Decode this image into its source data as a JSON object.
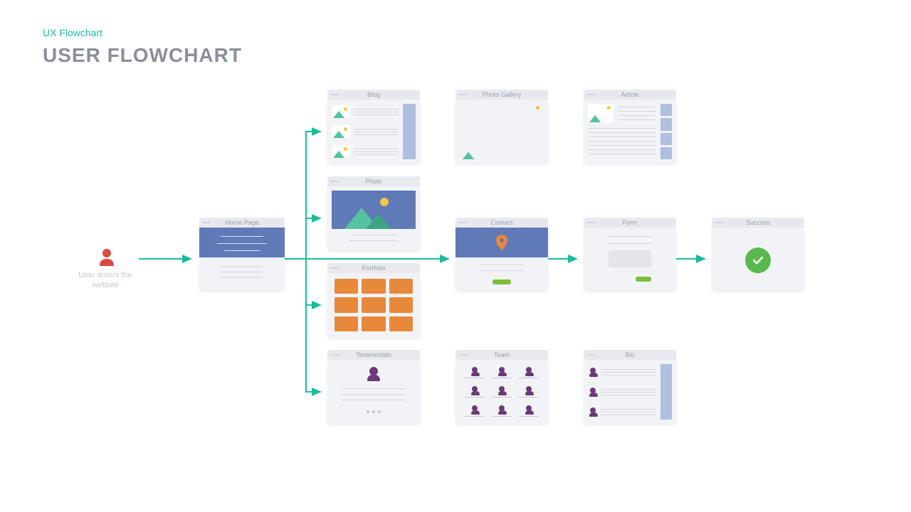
{
  "header": {
    "subtitle": "UX Flowchart",
    "title": "USER FLOWCHART"
  },
  "entry": {
    "label": "User enters the website"
  },
  "nodes": {
    "home": "Home Page",
    "blog": "Blog",
    "gallery": "Photo Gallery",
    "article": "Article",
    "photo": "Photo",
    "portfolio": "Portfolio",
    "testimonials": "Testimonials",
    "contact": "Contact",
    "team": "Team",
    "form": "Form",
    "bio": "Bio",
    "success": "Success"
  }
}
